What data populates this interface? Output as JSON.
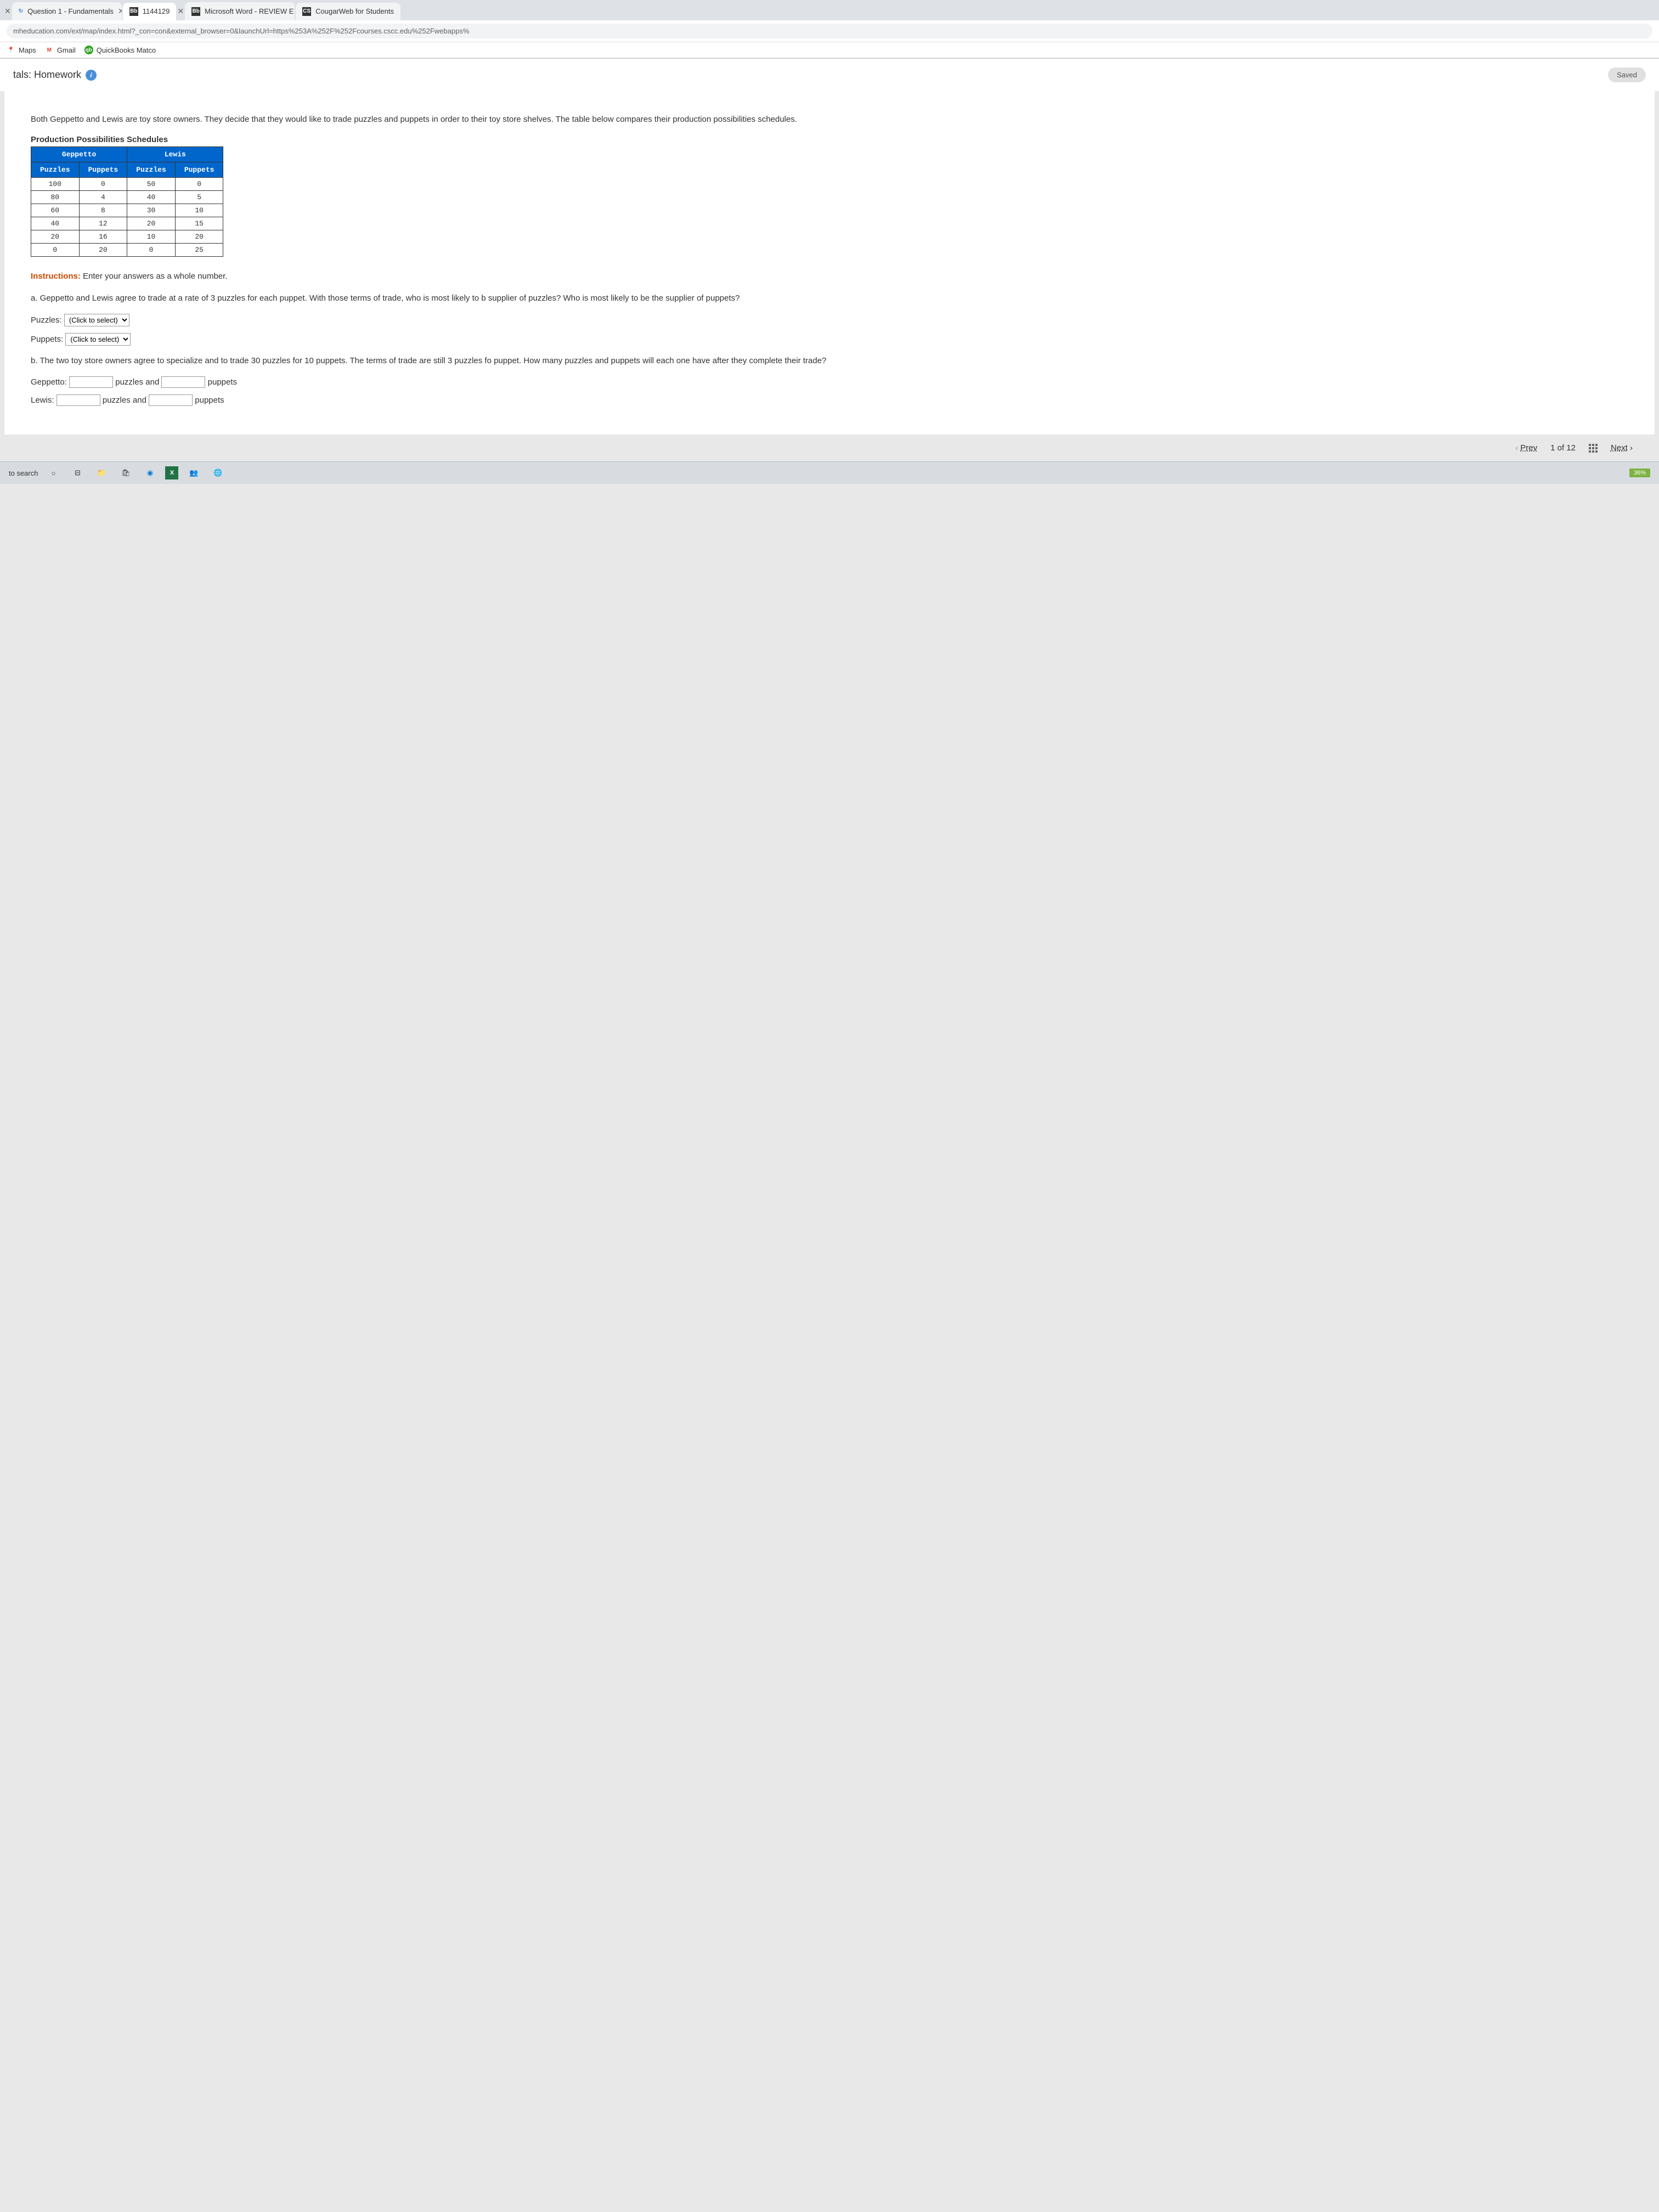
{
  "tabs": [
    {
      "label": "Question 1 - Fundamentals",
      "favicon": "↻",
      "favicon_bg": "#4285f4",
      "active": false
    },
    {
      "label": "1144129",
      "favicon": "Bb",
      "favicon_bg": "#333",
      "active": true
    },
    {
      "label": "Microsoft Word - REVIEW E",
      "favicon": "Bb",
      "favicon_bg": "#333",
      "active": false
    },
    {
      "label": "CougarWeb for Students",
      "favicon": "CS",
      "favicon_bg": "#333",
      "active": false
    }
  ],
  "url": "mheducation.com/ext/map/index.html?_con=con&external_browser=0&launchUrl=https%253A%252F%252Fcourses.cscc.edu%252Fwebapps%",
  "bookmarks": [
    {
      "label": "Maps",
      "icon": "📍",
      "icon_color": "#34a853"
    },
    {
      "label": "Gmail",
      "icon": "M",
      "icon_color": "#ea4335"
    },
    {
      "label": "QuickBooks Matco",
      "icon": "qb",
      "icon_color": "#2ca01c"
    }
  ],
  "header": {
    "title": "tals: Homework",
    "saved_label": "Saved"
  },
  "question": {
    "intro": "Both Geppetto and Lewis are toy store owners. They decide that they would like to trade puzzles and puppets in order to their toy store shelves. The table below compares their production possibilities schedules.",
    "table_title": "Production Possibilities Schedules",
    "instructions_label": "Instructions:",
    "instructions_text": " Enter your answers as a whole number.",
    "part_a": "a. Geppetto and Lewis agree to trade at a rate of 3 puzzles for each puppet. With those terms of trade, who is most likely to b supplier of puzzles? Who is most likely to be the supplier of puppets?",
    "puzzles_label": "Puzzles:",
    "puppets_label": "Puppets:",
    "select_placeholder": "(Click to select)",
    "part_b": "b. The two toy store owners agree to specialize and to trade 30 puzzles for 10 puppets. The terms of trade are still 3 puzzles fo puppet. How many puzzles and puppets will each one have after they complete their trade?",
    "geppetto_label": "Geppetto:",
    "lewis_label": "Lewis:",
    "puzzles_and": "puzzles and",
    "puppets_word": "puppets"
  },
  "chart_data": {
    "type": "table",
    "title": "Production Possibilities Schedules",
    "groups": [
      "Geppetto",
      "Lewis"
    ],
    "columns": [
      "Puzzles",
      "Puppets",
      "Puzzles",
      "Puppets"
    ],
    "rows": [
      [
        100,
        0,
        50,
        0
      ],
      [
        80,
        4,
        40,
        5
      ],
      [
        60,
        8,
        30,
        10
      ],
      [
        40,
        12,
        20,
        15
      ],
      [
        20,
        16,
        10,
        20
      ],
      [
        0,
        20,
        0,
        25
      ]
    ]
  },
  "nav": {
    "prev": "Prev",
    "counter": "1 of 12",
    "next": "Next"
  },
  "taskbar": {
    "search": "to search",
    "battery": "36%"
  }
}
